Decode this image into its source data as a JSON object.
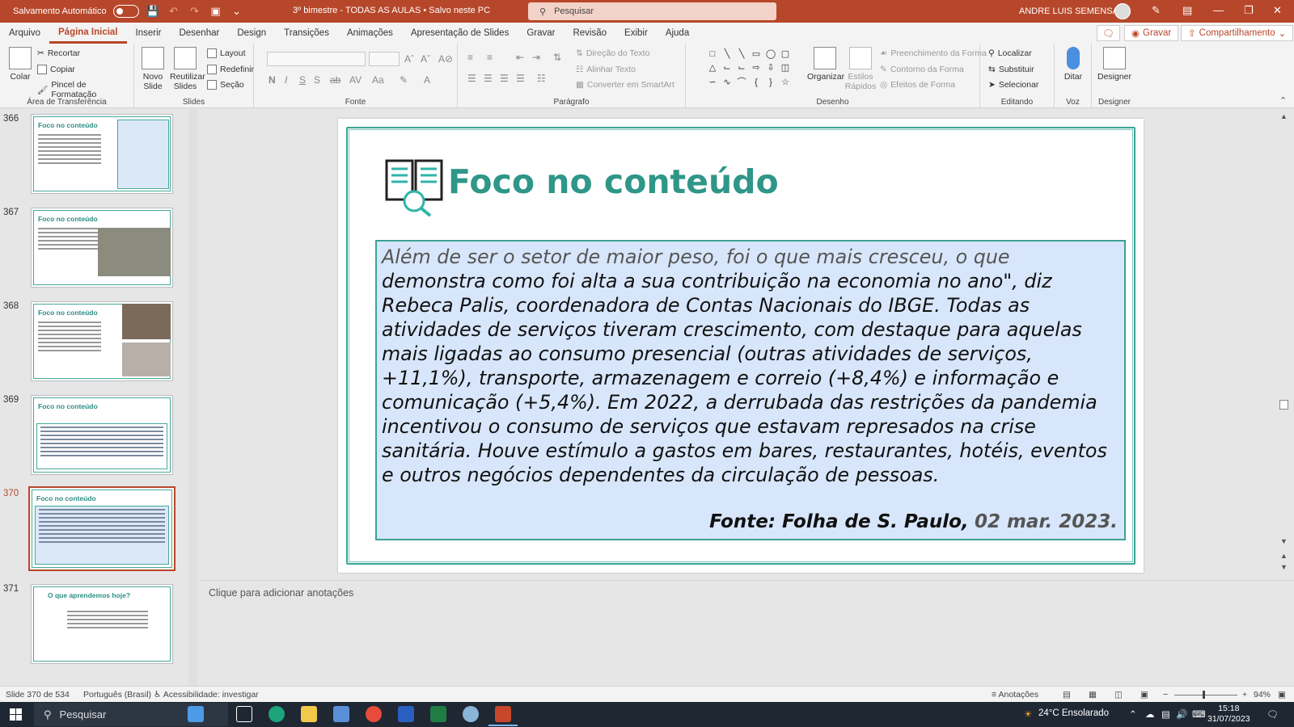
{
  "titlebar": {
    "autosave_label": "Salvamento Automático",
    "doc_title": "3º bimestre - TODAS AS AULAS • Salvo neste PC",
    "search_placeholder": "Pesquisar",
    "user_name": "ANDRE LUIS SEMENSATO"
  },
  "menu": {
    "tabs": [
      "Arquivo",
      "Página Inicial",
      "Inserir",
      "Desenhar",
      "Design",
      "Transições",
      "Animações",
      "Apresentação de Slides",
      "Gravar",
      "Revisão",
      "Exibir",
      "Ajuda"
    ],
    "active_tab": "Página Inicial",
    "record_button": "Gravar",
    "share_button": "Compartilhamento"
  },
  "ribbon": {
    "clipboard": {
      "paste": "Colar",
      "cut": "Recortar",
      "copy": "Copiar",
      "format_painter": "Pincel de Formatação",
      "label": "Área de Transferência"
    },
    "slides": {
      "new_slide": "Novo Slide",
      "reuse_slides": "Reutilizar Slides",
      "layout": "Layout",
      "reset": "Redefinir",
      "section": "Seção",
      "label": "Slides"
    },
    "font": {
      "label": "Fonte"
    },
    "paragraph": {
      "text_direction": "Direção do Texto",
      "align_text": "Alinhar Texto",
      "smartart": "Converter em SmartArt",
      "label": "Parágrafo"
    },
    "drawing": {
      "arrange": "Organizar",
      "quick_styles": "Estilos Rápidos",
      "shape_fill": "Preenchimento da Forma",
      "shape_outline": "Contorno da Forma",
      "shape_effects": "Efeitos de Forma",
      "label": "Desenho"
    },
    "editing": {
      "find": "Localizar",
      "replace": "Substituir",
      "select": "Selecionar",
      "label": "Editando"
    },
    "voice": {
      "dictate": "Ditar",
      "label": "Voz"
    },
    "designer": {
      "designer": "Designer",
      "label": "Designer"
    }
  },
  "thumbnails": [
    {
      "number": "366",
      "title": "Foco no conteúdo"
    },
    {
      "number": "367",
      "title": "Foco no conteúdo"
    },
    {
      "number": "368",
      "title": "Foco no conteúdo"
    },
    {
      "number": "369",
      "title": "Foco no conteúdo"
    },
    {
      "number": "370",
      "title": "Foco no conteúdo"
    },
    {
      "number": "371",
      "title": "O que aprendemos hoje?"
    }
  ],
  "slide": {
    "title": "Foco no conteúdo",
    "quote_lead": "Além de ser o setor de maior peso, foi o que mais cresceu, o que",
    "quote_body": "demonstra como foi alta a sua contribuição na economia no ano\", diz Rebeca Palis, coordenadora de Contas Nacionais do IBGE. Todas as atividades de serviços tiveram crescimento, com destaque para aquelas mais ligadas ao consumo presencial (outras atividades de serviços, +11,1%), transporte, armazenagem e correio (+8,4%) e informação e comunicação (+5,4%). Em 2022, a derrubada das restrições da pandemia incentivou o consumo de serviços que estavam represados na crise sanitária. Houve estímulo a gastos em bares, restaurantes, hotéis, eventos e outros negócios dependentes da circulação de pessoas.",
    "source_label": "Fonte: Folha de S. Paulo,",
    "source_date": "02 mar. 2023."
  },
  "notes": {
    "placeholder": "Clique para adicionar anotações"
  },
  "statusbar": {
    "slide_counter": "Slide 370 de 534",
    "language": "Português (Brasil)",
    "accessibility": "Acessibilidade: investigar",
    "notes_button": "Anotações",
    "zoom": "94%"
  },
  "taskbar": {
    "search_placeholder": "Pesquisar",
    "weather": "24°C  Ensolarado",
    "time": "15:18",
    "date": "31/07/2023"
  }
}
